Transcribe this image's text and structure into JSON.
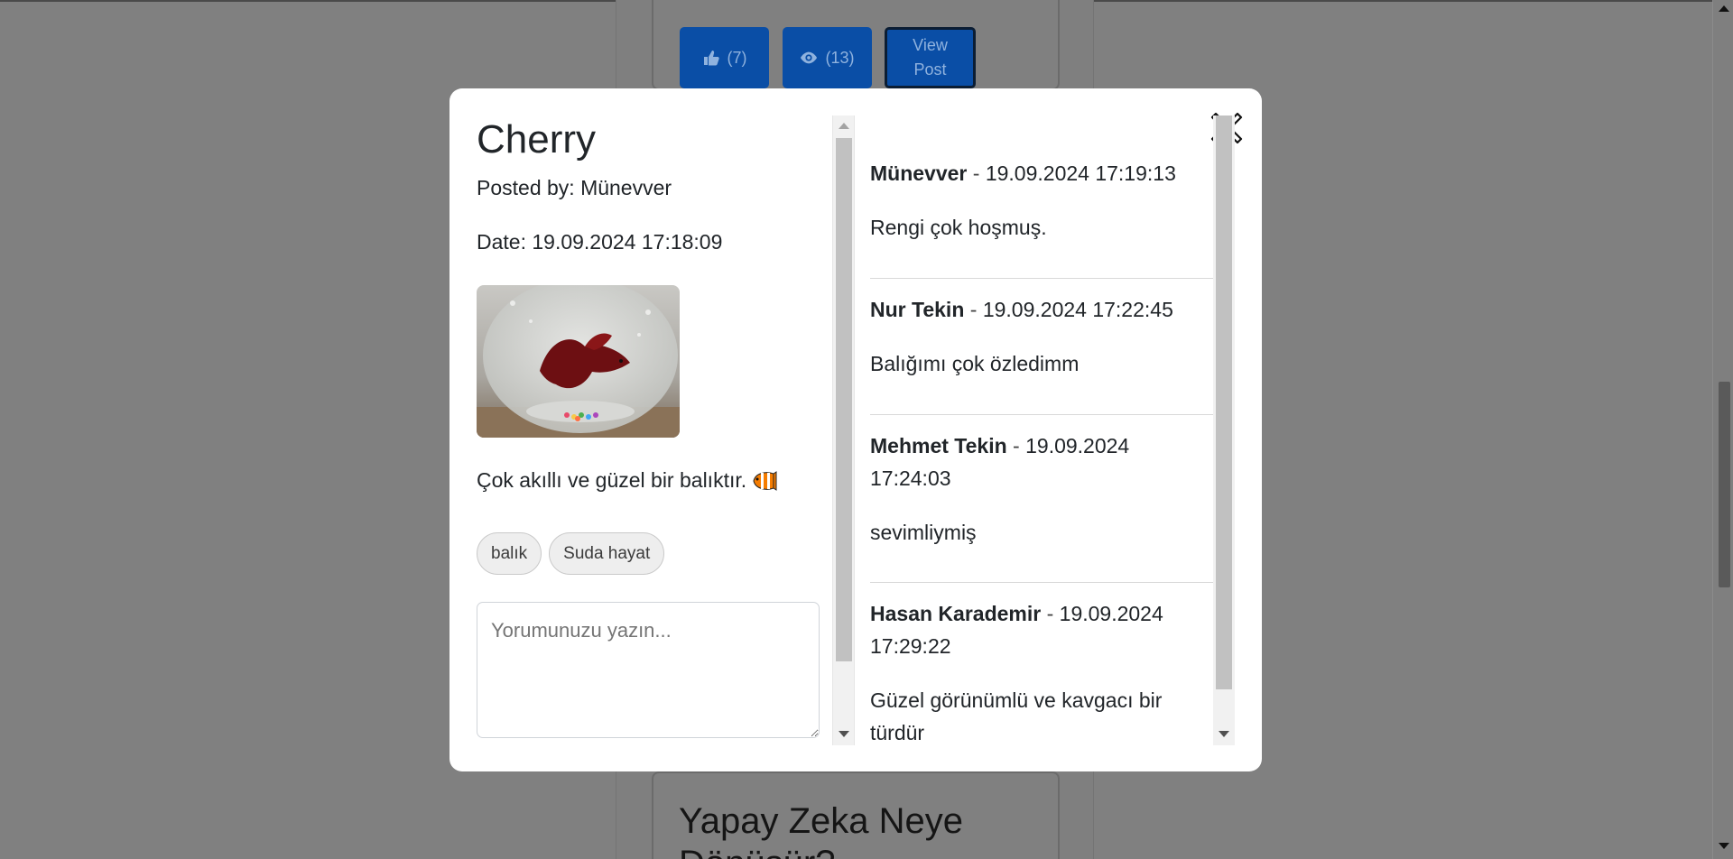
{
  "background": {
    "like_count": "(7)",
    "view_count": "(13)",
    "view_post_label": "View Post",
    "next_post_title_line1": "Yapay Zeka Neye",
    "next_post_title_line2": "Dönüşür?"
  },
  "modal": {
    "title": "Cherry",
    "posted_by": "Posted by: Münevver",
    "date": "Date: 19.09.2024 17:18:09",
    "description": "Çok akıllı ve güzel bir balıktır.",
    "description_icon": "tropical-fish-icon",
    "tags": [
      "balık",
      "Suda hayat"
    ],
    "comment_placeholder": "Yorumunuzu yazın...",
    "close_icon": "close-icon"
  },
  "comments": [
    {
      "author": "Münevver",
      "separator": " - ",
      "timestamp": "19.09.2024 17:19:13",
      "text": "Rengi çok hoşmuş."
    },
    {
      "author": "Nur Tekin",
      "separator": " - ",
      "timestamp": "19.09.2024 17:22:45",
      "text": "Balığımı çok özledimm"
    },
    {
      "author": "Mehmet Tekin",
      "separator": " - ",
      "timestamp": "19.09.2024 17:24:03",
      "text": "sevimliymiş"
    },
    {
      "author": "Hasan Karademir",
      "separator": " - ",
      "timestamp": "19.09.2024 17:29:22",
      "text": "Güzel görünümlü ve kavgacı bir türdür"
    }
  ],
  "colors": {
    "overlay": "#808080",
    "button_blue": "#0a4ea6",
    "modal_bg": "#ffffff",
    "text": "#212529"
  }
}
